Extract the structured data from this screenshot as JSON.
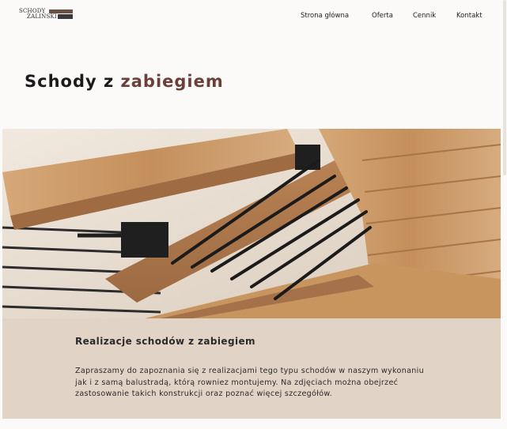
{
  "brand": {
    "logo_line1": "SCHODY",
    "logo_line2": "ZALIŃSKI"
  },
  "nav": {
    "items": [
      {
        "label": "Strona główna"
      },
      {
        "label": "Oferta"
      },
      {
        "label": "Cennik"
      },
      {
        "label": "Kontakt"
      }
    ]
  },
  "page": {
    "title_plain": "Schody z",
    "title_accent": "zabiegiem"
  },
  "hero": {
    "icon": "wooden-staircase-photo"
  },
  "section": {
    "heading": "Realizacje schodów z zabiegiem",
    "body": "Zapraszamy do zapoznania się z realizacjami tego typu schodów w naszym wykonaniu jak i z samą balustradą, którą rowniez montujemy. Na zdjęciach można obejrzeć zastosowanie takich konstrukcji oraz poznać więcej szczegółów."
  },
  "colors": {
    "background": "#fcfaf8",
    "accent": "#6a3f37",
    "panel": "#e1d4c6",
    "text": "#1d1d1d"
  }
}
